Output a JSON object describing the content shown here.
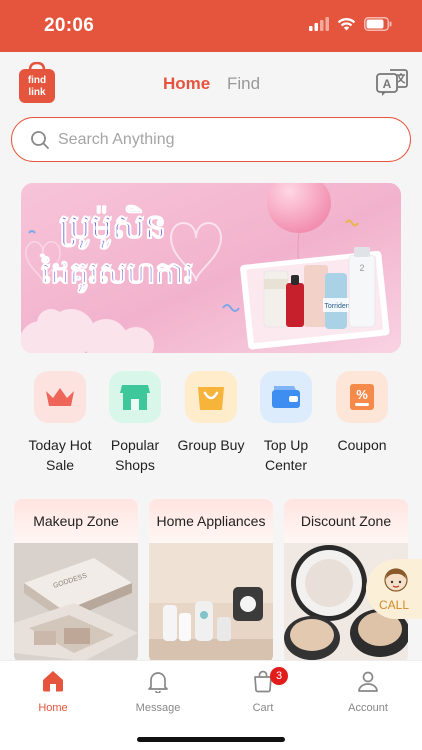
{
  "status_bar": {
    "time": "20:06"
  },
  "header": {
    "logo_text_line1": "find",
    "logo_text_line2": "link",
    "tabs": [
      {
        "label": "Home",
        "active": true
      },
      {
        "label": "Find",
        "active": false
      }
    ],
    "translate_icon": "translate-icon"
  },
  "search": {
    "placeholder": "Search Anything"
  },
  "banner": {
    "title_line1": "ប្រូម៉ូសិន",
    "title_line2": "ដៃគូរសហការ",
    "product_label": "Torriden",
    "product_number": "2"
  },
  "categories": [
    {
      "label_line1": "Today Hot",
      "label_line2": "Sale",
      "icon": "crown-icon",
      "color": "#fde3df"
    },
    {
      "label_line1": "Popular",
      "label_line2": "Shops",
      "icon": "shop-icon",
      "color": "#d9f6ea"
    },
    {
      "label_line1": "Group Buy",
      "label_line2": "",
      "icon": "bag-icon",
      "color": "#feeccb"
    },
    {
      "label_line1": "Top Up",
      "label_line2": "Center",
      "icon": "wallet-icon",
      "color": "#dcecfd"
    },
    {
      "label_line1": "Coupon",
      "label_line2": "",
      "icon": "coupon-icon",
      "color": "#fde6d8"
    }
  ],
  "zones": [
    {
      "title": "Makeup Zone"
    },
    {
      "title": "Home Appliances"
    },
    {
      "title": "Discount Zone"
    }
  ],
  "call": {
    "label": "CALL"
  },
  "bottom_nav": [
    {
      "label": "Home",
      "icon": "home-icon",
      "active": true
    },
    {
      "label": "Message",
      "icon": "bell-icon",
      "active": false
    },
    {
      "label": "Cart",
      "icon": "cart-icon",
      "active": false,
      "badge": "3"
    },
    {
      "label": "Account",
      "icon": "user-icon",
      "active": false
    }
  ],
  "colors": {
    "accent": "#e5553d",
    "badge": "#e21b1b"
  }
}
